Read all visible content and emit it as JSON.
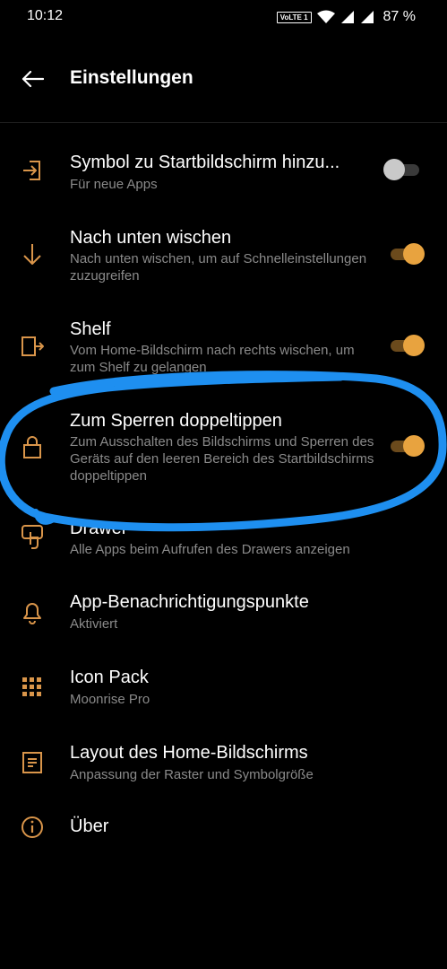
{
  "status_bar": {
    "time": "10:12",
    "network_badge": "VoLTE 1",
    "battery_percent": "87 %",
    "icons": [
      "wifi-icon",
      "signal-icon",
      "signal-icon",
      "battery-icon"
    ]
  },
  "app_bar": {
    "back_icon": "arrow-left-icon",
    "title": "Einstellungen"
  },
  "settings": [
    {
      "icon": "exit-to-app-icon",
      "title": "Symbol zu Startbildschirm hinzu...",
      "subtitle": "Für neue Apps",
      "toggle": "off"
    },
    {
      "icon": "arrow-down-icon",
      "title": "Nach unten wischen",
      "subtitle": "Nach unten wischen, um auf Schnelleinstellungen zuzugreifen",
      "toggle": "on"
    },
    {
      "icon": "shelf-icon",
      "title": "Shelf",
      "subtitle": "Vom Home-Bildschirm nach rechts wischen, um zum Shelf zu gelangen",
      "toggle": "on"
    },
    {
      "icon": "lock-icon",
      "title": "Zum Sperren doppeltippen",
      "subtitle": "Zum Ausschalten des Bildschirms und Sperren des Geräts auf den leeren Bereich des Startbildschirms doppeltippen",
      "toggle": "on"
    },
    {
      "icon": "drawer-touch-icon",
      "title": "Drawer",
      "subtitle": "Alle Apps beim Aufrufen des Drawers anzeigen"
    },
    {
      "icon": "bell-icon",
      "title": "App-Benachrichtigungspunkte",
      "subtitle": "Aktiviert"
    },
    {
      "icon": "grid-icon",
      "title": "Icon Pack",
      "subtitle": "Moonrise Pro"
    },
    {
      "icon": "layout-icon",
      "title": "Layout des Home-Bildschirms",
      "subtitle": "Anpassung der Raster und Symbolgröße"
    },
    {
      "icon": "info-icon",
      "title": "Über"
    }
  ],
  "colors": {
    "background": "#000000",
    "accent": "#e8a33f",
    "icon": "#d9954a",
    "subtitle": "#8a8a8a",
    "annotation": "#1e8ff0"
  }
}
